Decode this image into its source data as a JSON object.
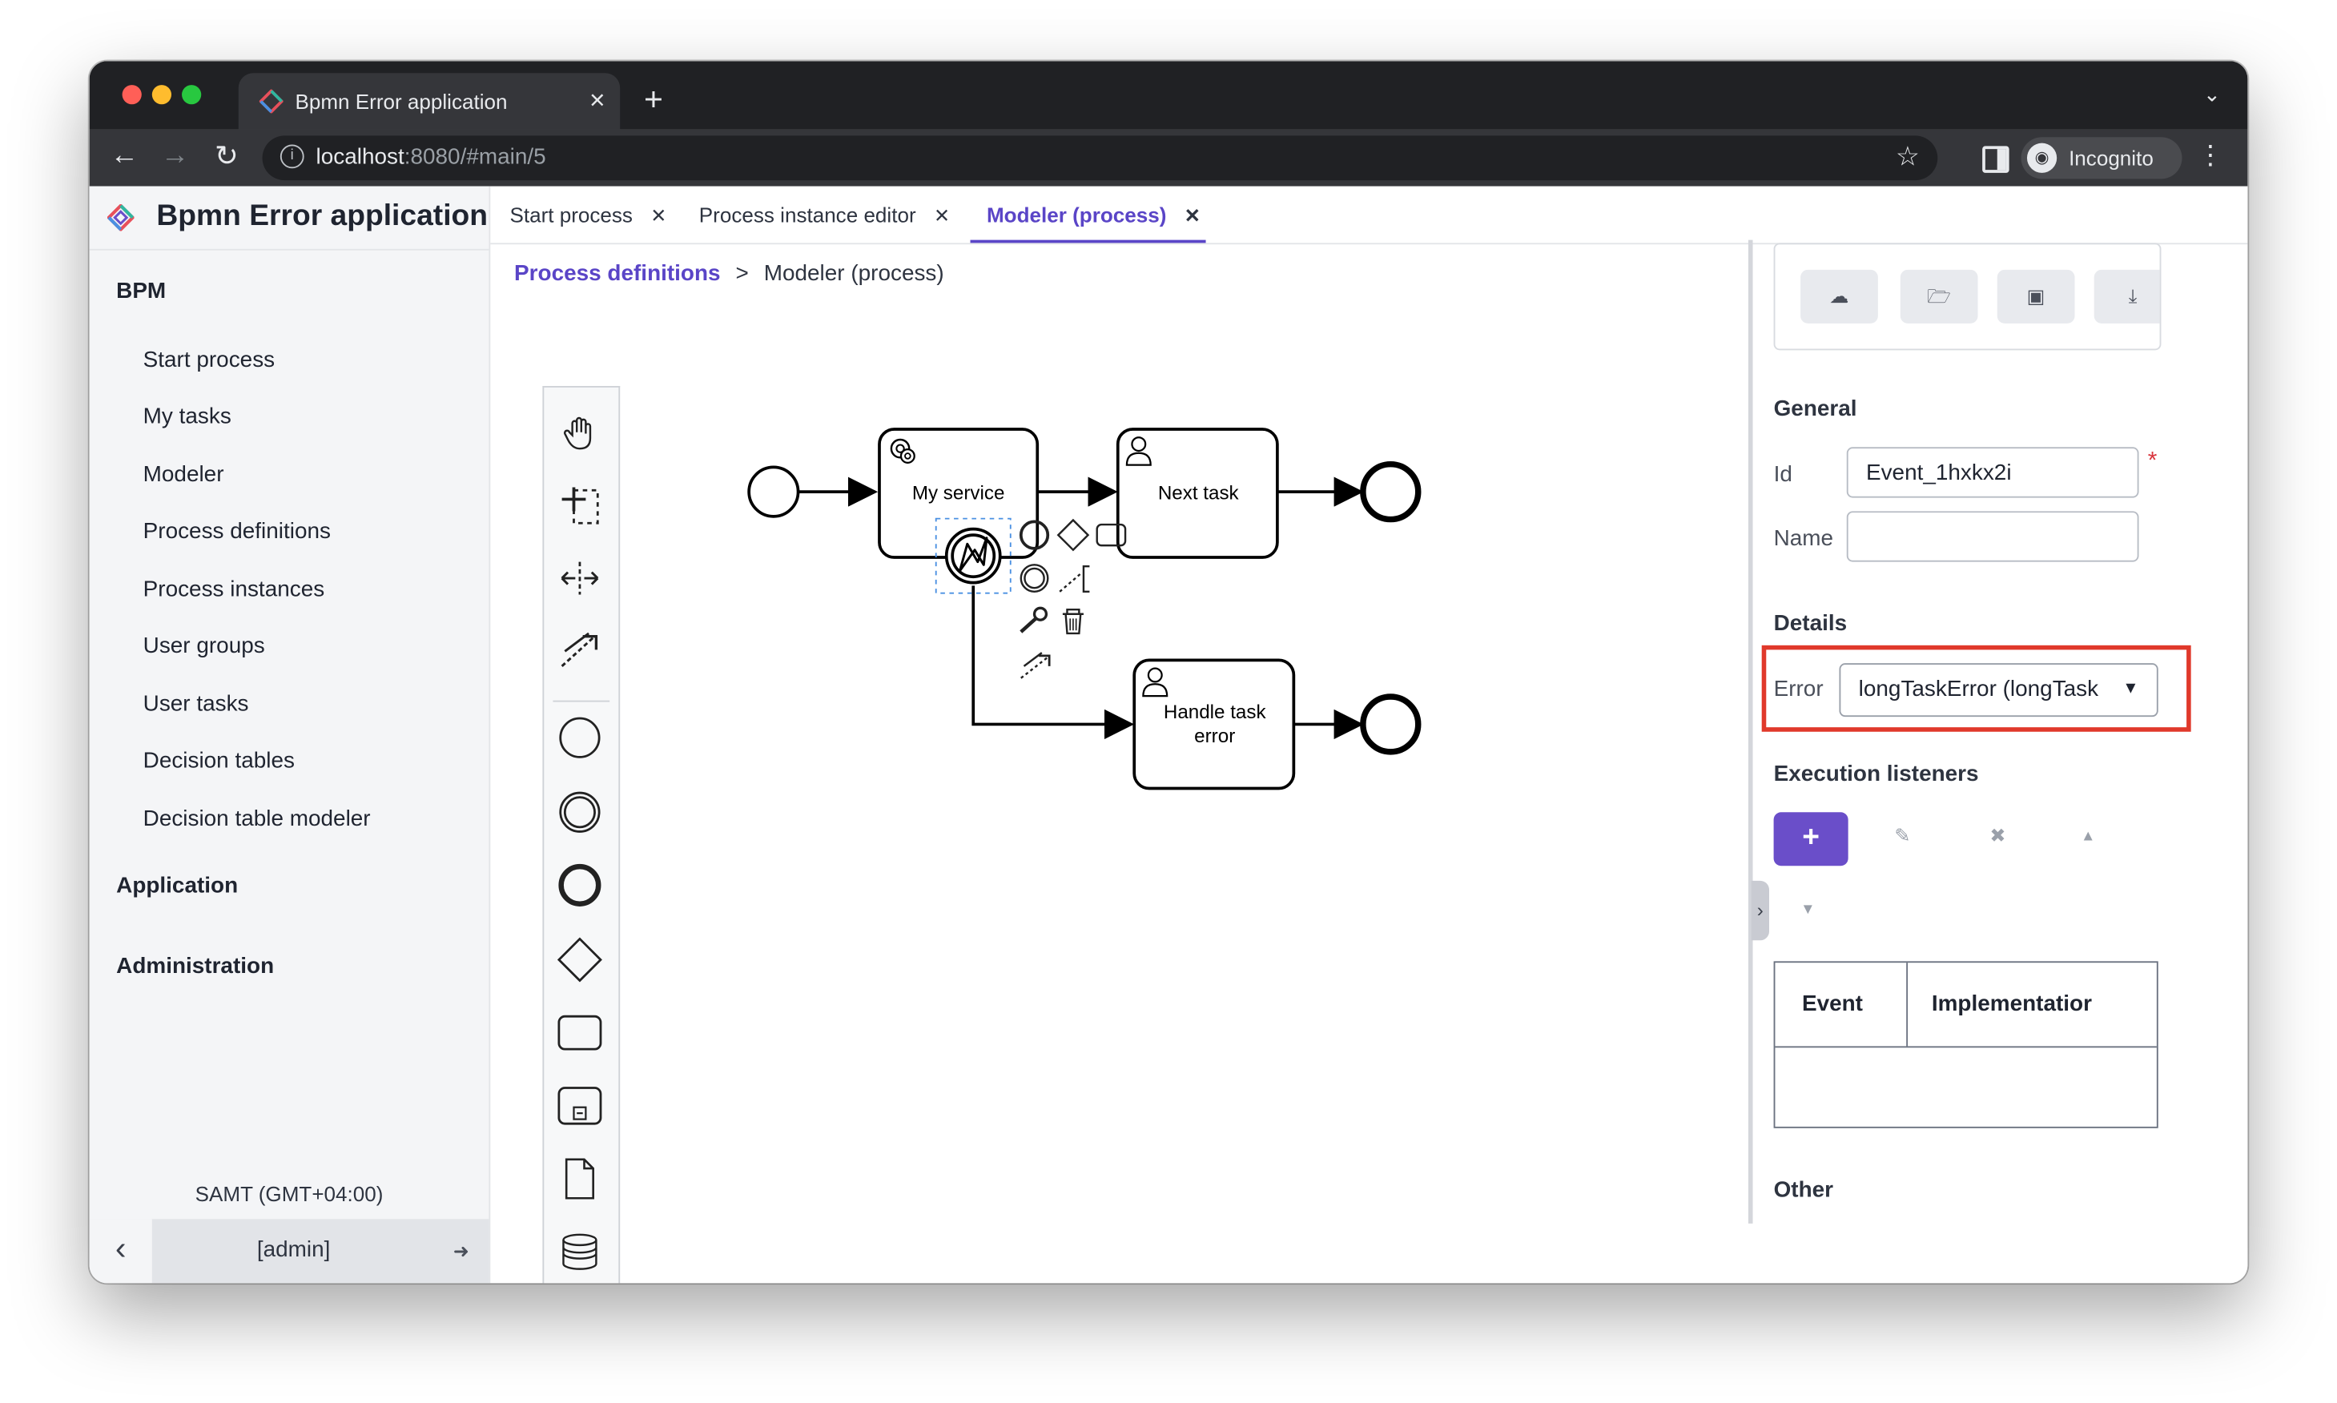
{
  "browser": {
    "tab_title": "Bpmn Error application",
    "url_host": "localhost",
    "url_rest": ":8080/#main/5",
    "profile_label": "Incognito"
  },
  "app": {
    "brand": "Bpmn Error application",
    "menu": {
      "groups": [
        {
          "label": "BPM"
        },
        {
          "label": "Application"
        },
        {
          "label": "Administration"
        }
      ],
      "bpm_items": [
        {
          "label": "Start process"
        },
        {
          "label": "My tasks"
        },
        {
          "label": "Modeler"
        },
        {
          "label": "Process definitions"
        },
        {
          "label": "Process instances"
        },
        {
          "label": "User groups"
        },
        {
          "label": "User tasks"
        },
        {
          "label": "Decision tables"
        },
        {
          "label": "Decision table modeler"
        }
      ]
    },
    "timezone": "SAMT (GMT+04:00)",
    "user": "[admin]"
  },
  "tabs": [
    {
      "label": "Start process",
      "active": false
    },
    {
      "label": "Process instance editor",
      "active": false
    },
    {
      "label": "Modeler (process)",
      "active": true
    }
  ],
  "breadcrumb": {
    "link": "Process definitions",
    "separator": ">",
    "current": "Modeler (process)"
  },
  "diagram": {
    "tasks": [
      {
        "label": "My service"
      },
      {
        "label": "Next task"
      },
      {
        "label1": "Handle task",
        "label2": "error"
      }
    ]
  },
  "properties": {
    "general_title": "General",
    "id_label": "Id",
    "id_value": "Event_1hxkx2i",
    "required_mark": "*",
    "name_label": "Name",
    "name_value": "",
    "details_title": "Details",
    "error_label": "Error",
    "error_value": "longTaskError (longTask",
    "execution_listeners_title": "Execution listeners",
    "add_button": "+",
    "table_headers": [
      "Event",
      "Implementatior"
    ],
    "other_title": "Other"
  },
  "colors": {
    "accent": "#5a45c7",
    "primary_button": "#6a4ec9",
    "highlight_box": "#e0392b"
  }
}
